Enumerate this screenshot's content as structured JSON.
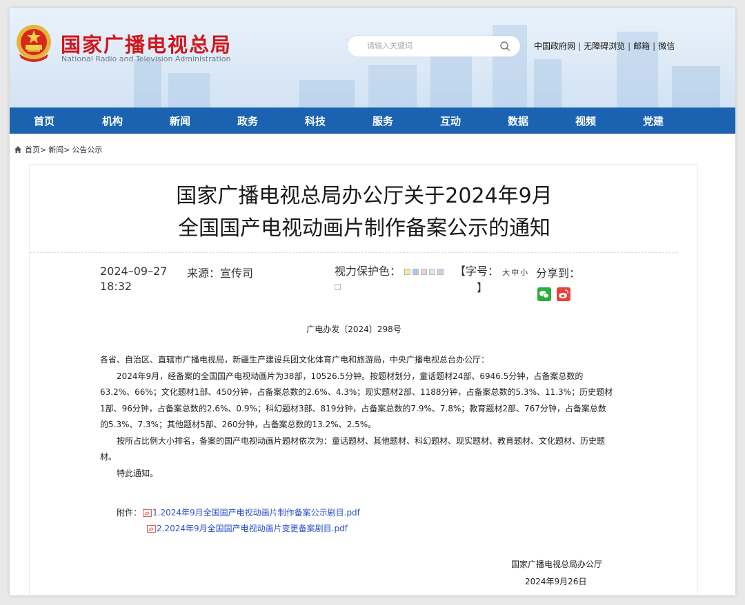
{
  "header": {
    "site_title": "国家广播电视总局",
    "site_subtitle": "National Radio and Television Administration",
    "emblem_icon": "national-emblem-icon",
    "search_placeholder": "请输入关键词",
    "search_icon": "search-icon",
    "top_links": [
      "中国政府网",
      "无障碍浏览",
      "邮箱",
      "微信"
    ],
    "brand_color": "#d0161b"
  },
  "nav": {
    "color": "#1b63b1",
    "items": [
      "首页",
      "机构",
      "新闻",
      "政务",
      "科技",
      "服务",
      "互动",
      "数据",
      "视频",
      "党建"
    ]
  },
  "breadcrumb": {
    "home_icon": "home-icon",
    "items": [
      "首页>",
      "新闻>",
      "公告公示"
    ]
  },
  "article": {
    "title_line1": "国家广播电视总局办公厅关于2024年9月",
    "title_line2": "全国国产电视动画片制作备案公示的通知",
    "date": "2024–09–27 18:32",
    "source": "来源：宣传司",
    "vision_label": "视力保护色：",
    "vision_swatches": [
      "#f5e7a5",
      "#a8c8f0",
      "#f0d0d8",
      "#e6e6e6",
      "#d8c8ec",
      "#ffffff"
    ],
    "font_label_open": "【字号：",
    "font_sizes": [
      "大",
      "中",
      "小"
    ],
    "font_label_close": "】",
    "share_label": "分享到：",
    "share_icons": [
      "wechat-icon",
      "weibo-icon"
    ],
    "doc_number": "广电办发〔2024〕298号",
    "paragraphs": [
      "各省、自治区、直辖市广播电视局，新疆生产建设兵团文化体育广电和旅游局，中央广播电视总台办公厅：",
      "2024年9月，经备案的全国国产电视动画片为38部，10526.5分钟。按题材划分，童话题材24部、6946.5分钟，占备案总数的63.2%、66%；文化题材1部、450分钟，占备案总数的2.6%、4.3%；现实题材2部、1188分钟，占备案总数的5.3%、11.3%；历史题材1部、96分钟，占备案总数的2.6%、0.9%；科幻题材3部、819分钟，占备案总数的7.9%、7.8%；教育题材2部、767分钟，占备案总数的5.3%、7.3%；其他题材5部、260分钟，占备案总数的13.2%、2.5%。",
      "按所占比例大小排名，备案的国产电视动画片题材依次为：童话题材、其他题材、科幻题材、现实题材、教育题材、文化题材、历史题材。",
      "特此通知。"
    ],
    "attachments_label": "附件：",
    "attachments": [
      "1.2024年9月全国国产电视动画片制作备案公示剧目.pdf",
      "2.2024年9月全国国产电视动画片变更备案剧目.pdf"
    ],
    "signature_org": "国家广播电视总局办公厅",
    "signature_date": "2024年9月26日"
  }
}
